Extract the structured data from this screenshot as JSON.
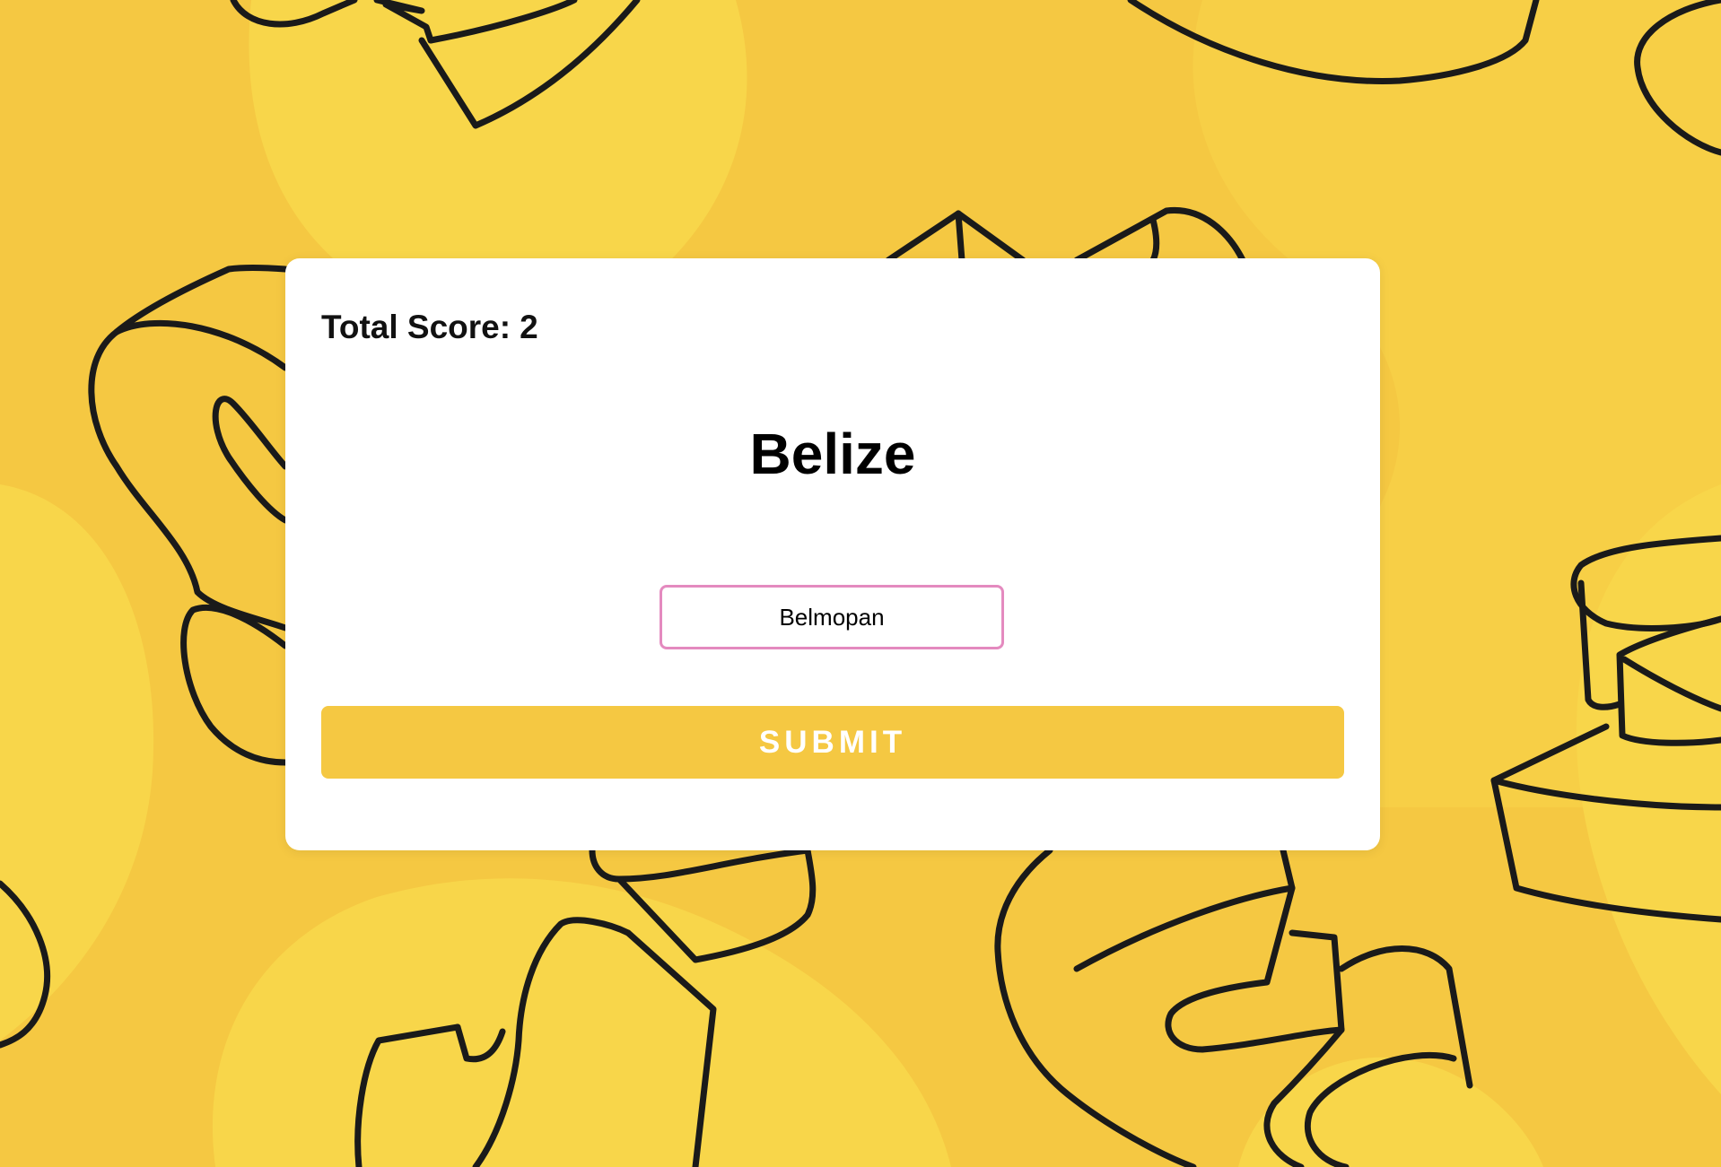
{
  "colors": {
    "background": "#f5c842",
    "background_light": "#f8d64a",
    "doodle_stroke": "#1a1a1a",
    "card": "#ffffff",
    "input_border": "#e48abf",
    "submit_bg": "#f5c842",
    "submit_text": "#ffffff"
  },
  "score": {
    "label": "Total Score:",
    "value": "2"
  },
  "question": {
    "country": "Belize"
  },
  "answer": {
    "value": "Belmopan"
  },
  "submit": {
    "label": "SUBMIT"
  }
}
